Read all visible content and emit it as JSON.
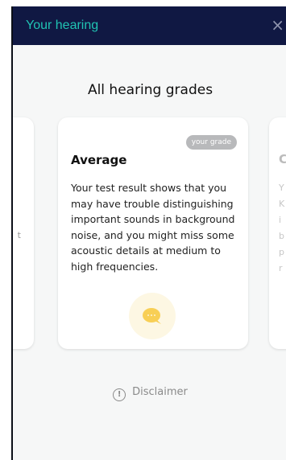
{
  "header": {
    "title": "Your hearing",
    "close_glyph": "×"
  },
  "section": {
    "title": "All hearing grades"
  },
  "current_card": {
    "badge": "your grade",
    "title": "Average",
    "text": "Your test result shows that you may have trouble distinguishing important sounds in background noise, and you might miss some acoustic details at medium to high frequencies.",
    "icon": "chat-bubble-icon"
  },
  "left_card": {
    "fragment": "t"
  },
  "right_card": {
    "fragments": [
      "C",
      "Y",
      "K",
      "i",
      "b",
      "p",
      "r"
    ]
  },
  "disclaimer": {
    "label": "Disclaimer",
    "icon": "info-icon"
  },
  "colors": {
    "header_bg": "#101843",
    "header_title": "#20c3b3",
    "bubble": "#f8cf55"
  }
}
